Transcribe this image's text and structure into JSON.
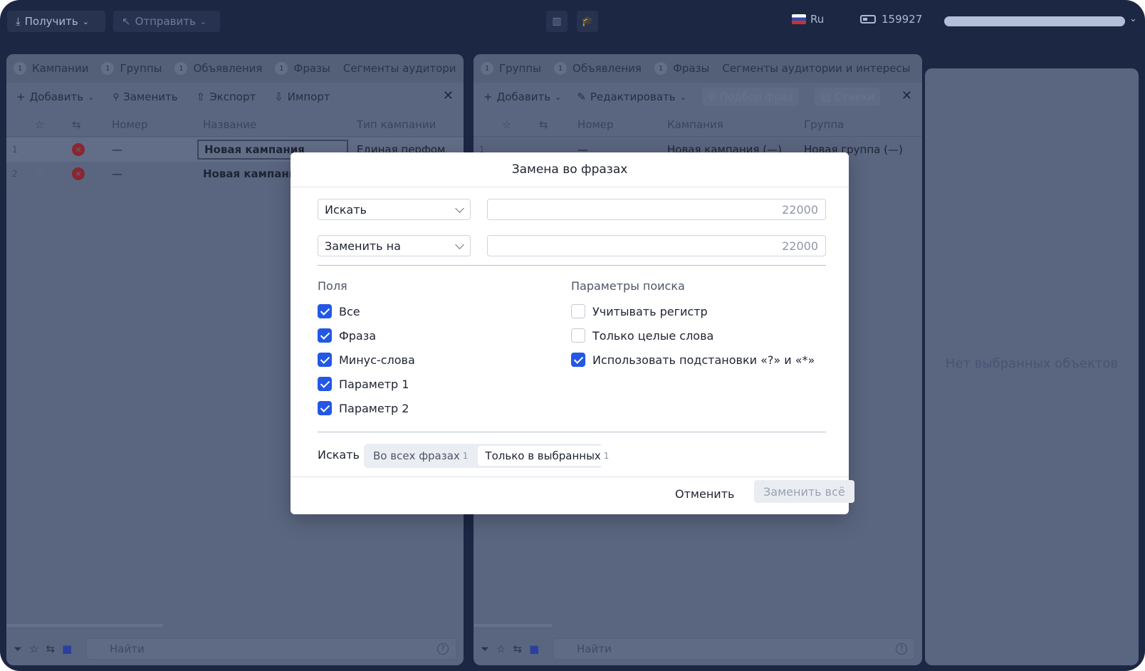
{
  "topbar": {
    "get_label": "Получить",
    "send_label": "Отправить",
    "language": "Ru",
    "balance": "159927"
  },
  "left_panel": {
    "tabs": [
      {
        "count": "1",
        "label": "Кампании"
      },
      {
        "count": "1",
        "label": "Группы"
      },
      {
        "count": "1",
        "label": "Объявления"
      },
      {
        "count": "1",
        "label": "Фразы"
      },
      {
        "count": "",
        "label": "Сегменты аудитори"
      }
    ],
    "actions": {
      "add": "Добавить",
      "replace": "Заменить",
      "export": "Экспорт",
      "import": "Импорт"
    },
    "columns": {
      "number": "Номер",
      "name": "Название",
      "type": "Тип кампании"
    },
    "rows": [
      {
        "index": "1",
        "number": "—",
        "name": "Новая кампания",
        "type": "Единая перфом"
      },
      {
        "index": "2",
        "number": "—",
        "name": "Новая кампания",
        "type": ""
      }
    ],
    "search_placeholder": "Найти"
  },
  "middle_panel": {
    "tabs": [
      {
        "count": "1",
        "label": "Группы"
      },
      {
        "count": "1",
        "label": "Объявления"
      },
      {
        "count": "1",
        "label": "Фразы"
      },
      {
        "count": "",
        "label": "Сегменты аудитории и интересы"
      }
    ],
    "actions": {
      "add": "Добавить",
      "edit": "Редактировать",
      "phrase_selection": "Подбор фраз",
      "bids": "Ставки"
    },
    "columns": {
      "number": "Номер",
      "campaign": "Кампания",
      "group": "Группа"
    },
    "rows": [
      {
        "index": "1",
        "number": "—",
        "campaign": "Новая кампания (—)",
        "group": "Новая группа (—)"
      }
    ],
    "search_placeholder": "Найти"
  },
  "right_panel": {
    "empty_message": "Нет выбранных объектов"
  },
  "modal": {
    "title": "Замена во фразах",
    "search_select": "Искать",
    "search_value": "22000",
    "replace_select": "Заменить на",
    "replace_value": "22000",
    "fields_title": "Поля",
    "fields": [
      {
        "label": "Все",
        "checked": true
      },
      {
        "label": "Фраза",
        "checked": true
      },
      {
        "label": "Минус-слова",
        "checked": true
      },
      {
        "label": "Параметр 1",
        "checked": true
      },
      {
        "label": "Параметр 2",
        "checked": true
      }
    ],
    "params_title": "Параметры поиска",
    "params": [
      {
        "label": "Учитывать регистр",
        "checked": false
      },
      {
        "label": "Только целые слова",
        "checked": false
      },
      {
        "label": "Использовать подстановки «?» и «*»",
        "checked": true
      }
    ],
    "scope_label": "Искать",
    "scope_options": [
      {
        "label": "Во всех фразах",
        "count": "1",
        "active": false
      },
      {
        "label": "Только в выбранных",
        "count": "1",
        "active": true
      }
    ],
    "cancel_label": "Отменить",
    "replace_all_label": "Заменить всё"
  },
  "colors": {
    "accent": "#2357e6",
    "frame": "#1c2744",
    "overlay_panel": "#5a6680",
    "error_icon": "#8a2630"
  }
}
